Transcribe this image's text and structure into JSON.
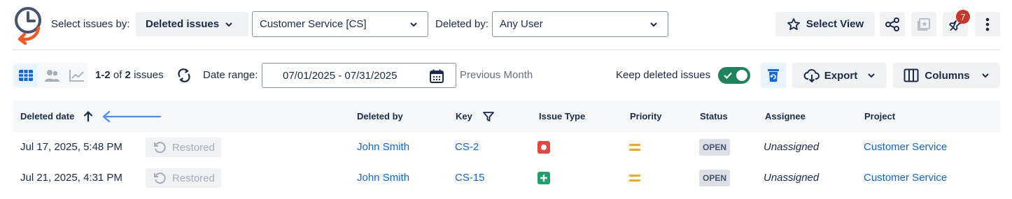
{
  "toolbar": {
    "select_label": "Select issues by:",
    "select_value": "Deleted issues",
    "project_value": "Customer Service [CS]",
    "deleted_by_label": "Deleted by:",
    "deleted_by_value": "Any User",
    "select_view_label": "Select View",
    "notification_count": "7"
  },
  "subbar": {
    "range_start": "1",
    "range_end": "2",
    "of_text": "of",
    "total": "2",
    "issues_text": "issues",
    "date_range_label": "Date range:",
    "date_range_value": "07/01/2025 - 07/31/2025",
    "preset_label": "Previous Month",
    "keep_deleted_label": "Keep deleted issues",
    "export_label": "Export",
    "columns_label": "Columns"
  },
  "table": {
    "columns": [
      "Deleted date",
      "Deleted by",
      "Key",
      "Issue Type",
      "Priority",
      "Status",
      "Assignee",
      "Project"
    ],
    "rows": [
      {
        "deleted_date": "Jul 17, 2025, 5:48 PM",
        "restore_label": "Restored",
        "deleted_by": "John Smith",
        "key": "CS-2",
        "issue_type_icon": "bug-icon",
        "priority": "medium",
        "status": "OPEN",
        "assignee": "Unassigned",
        "project": "Customer Service"
      },
      {
        "deleted_date": "Jul 21, 2025, 4:31 PM",
        "restore_label": "Restored",
        "deleted_by": "John Smith",
        "key": "CS-15",
        "issue_type_icon": "new-feature-icon",
        "priority": "medium",
        "status": "OPEN",
        "assignee": "Unassigned",
        "project": "Customer Service"
      }
    ]
  },
  "colors": {
    "accent": "#0c66e4",
    "toggle_on": "#1f845a",
    "bug": "#e2483d",
    "feature": "#22a06b",
    "priority_medium": "#f5a623",
    "badge": "#c9372c"
  }
}
